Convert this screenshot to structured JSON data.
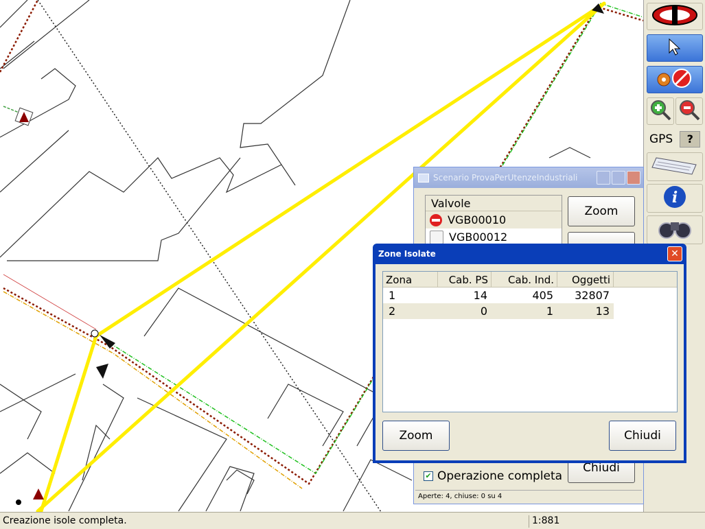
{
  "scenario_window": {
    "title": "Scenario ProvaPerUtenzeIndustriali",
    "list_header": "Valvole",
    "valves": [
      {
        "name": "VGB00010",
        "icon": "no-entry-icon"
      },
      {
        "name": "VGB00012",
        "icon": "checkbox-icon"
      }
    ],
    "zoom_button": "Zoom",
    "close_button": "Chiudi",
    "operation_checkbox": "Operazione completa",
    "status": "Aperte: 4, chiuse: 0 su 4"
  },
  "zone_window": {
    "title": "Zone Isolate",
    "columns": [
      "Zona",
      "Cab. PS",
      "Cab. Ind.",
      "Oggetti"
    ],
    "rows": [
      {
        "zona": "1",
        "cab_ps": "14",
        "cab_ind": "405",
        "oggetti": "32807"
      },
      {
        "zona": "2",
        "cab_ps": "0",
        "cab_ind": "1",
        "oggetti": "13"
      }
    ],
    "zoom_button": "Zoom",
    "close_button": "Chiudi"
  },
  "toolbar": {
    "gps_label": "GPS",
    "gps_help": "?",
    "icons": [
      "logo-icon",
      "pointer-icon",
      "settings-disabled-icon",
      "zoom-in-icon",
      "zoom-out-icon",
      "keyboard-icon",
      "info-icon",
      "binoculars-icon"
    ]
  },
  "statusbar": {
    "message": "Creazione isole completa.",
    "scale": "1:881"
  },
  "colors": {
    "highlight_line": "#ffea00",
    "window_title_active": "#0a3eb8"
  }
}
